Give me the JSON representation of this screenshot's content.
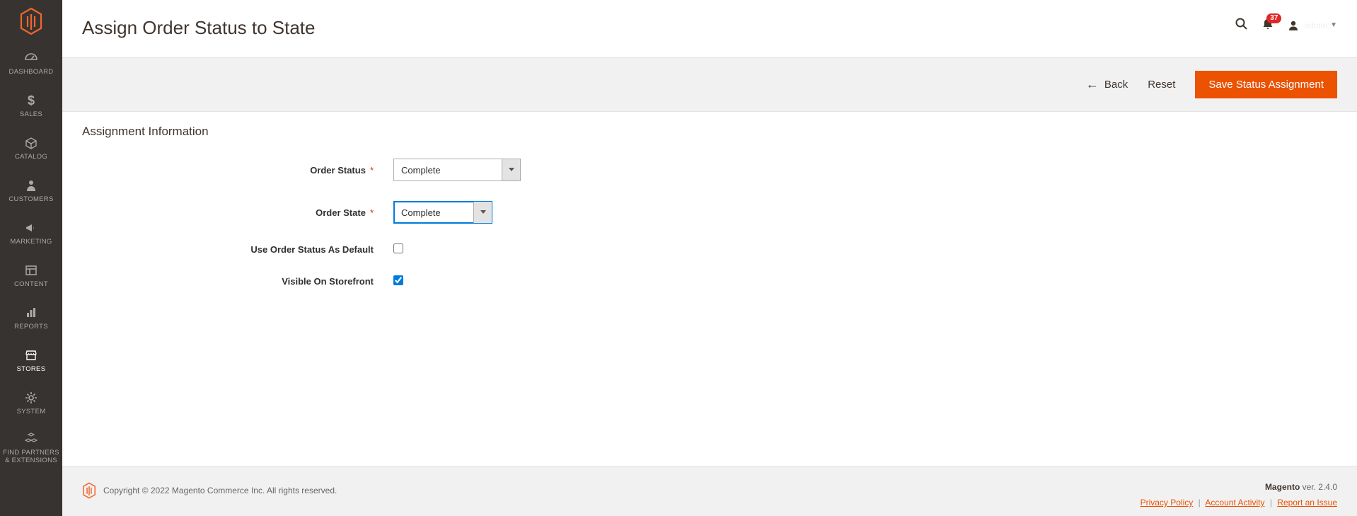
{
  "sidebar": {
    "items": [
      {
        "label": "DASHBOARD",
        "icon": "dashboard"
      },
      {
        "label": "SALES",
        "icon": "dollar"
      },
      {
        "label": "CATALOG",
        "icon": "box"
      },
      {
        "label": "CUSTOMERS",
        "icon": "person"
      },
      {
        "label": "MARKETING",
        "icon": "megaphone"
      },
      {
        "label": "CONTENT",
        "icon": "layout"
      },
      {
        "label": "REPORTS",
        "icon": "bars"
      },
      {
        "label": "STORES",
        "icon": "storefront",
        "active": true
      },
      {
        "label": "SYSTEM",
        "icon": "gear"
      },
      {
        "label": "FIND PARTNERS\n& EXTENSIONS",
        "icon": "cubes"
      }
    ]
  },
  "header": {
    "title": "Assign Order Status to State",
    "notif_count": "37",
    "username": "admin"
  },
  "actionbar": {
    "back_label": "Back",
    "reset_label": "Reset",
    "save_label": "Save Status Assignment"
  },
  "section": {
    "title": "Assignment Information",
    "order_status_label": "Order Status",
    "order_status_value": "Complete",
    "order_state_label": "Order State",
    "order_state_value": "Complete",
    "use_default_label": "Use Order Status As Default",
    "use_default_checked": false,
    "visible_label": "Visible On Storefront",
    "visible_checked": true
  },
  "footer": {
    "copyright": "Copyright © 2022 Magento Commerce Inc. All rights reserved.",
    "product": "Magento",
    "version_prefix": " ver. ",
    "version": "2.4.0",
    "link_privacy": "Privacy Policy",
    "link_activity": "Account Activity",
    "link_report": "Report an Issue"
  }
}
